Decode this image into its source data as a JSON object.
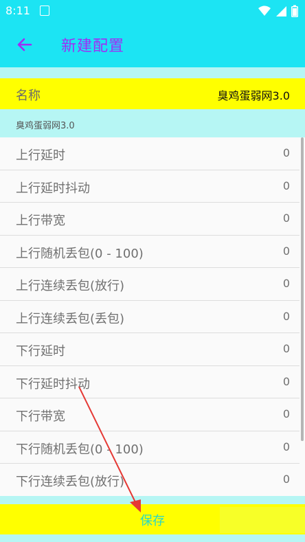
{
  "status": {
    "time": "8:11"
  },
  "appbar": {
    "title": "新建配置"
  },
  "name": {
    "label": "名称",
    "value": "臭鸡蛋弱网3.0"
  },
  "subtitle": "臭鸡蛋弱网3.0",
  "settings": [
    {
      "label": "上行延时",
      "value": "0"
    },
    {
      "label": "上行延时抖动",
      "value": "0"
    },
    {
      "label": "上行带宽",
      "value": "0"
    },
    {
      "label": "上行随机丢包(0 - 100)",
      "value": "0"
    },
    {
      "label": "上行连续丢包(放行)",
      "value": "0"
    },
    {
      "label": "上行连续丢包(丢包)",
      "value": "0"
    },
    {
      "label": "下行延时",
      "value": "0"
    },
    {
      "label": "下行延时抖动",
      "value": "0"
    },
    {
      "label": "下行带宽",
      "value": "0"
    },
    {
      "label": "下行随机丢包(0 - 100)",
      "value": "0"
    },
    {
      "label": "下行连续丢包(放行)",
      "value": "0"
    }
  ],
  "save": {
    "label": "保存"
  },
  "colors": {
    "accent": "#1ce4f3",
    "title": "#a02cf5",
    "highlight": "#ffff00",
    "annotation": "#e53935"
  },
  "icons": [
    "back-arrow-icon",
    "notification-icon",
    "wifi-icon",
    "signal-icon",
    "battery-icon"
  ]
}
